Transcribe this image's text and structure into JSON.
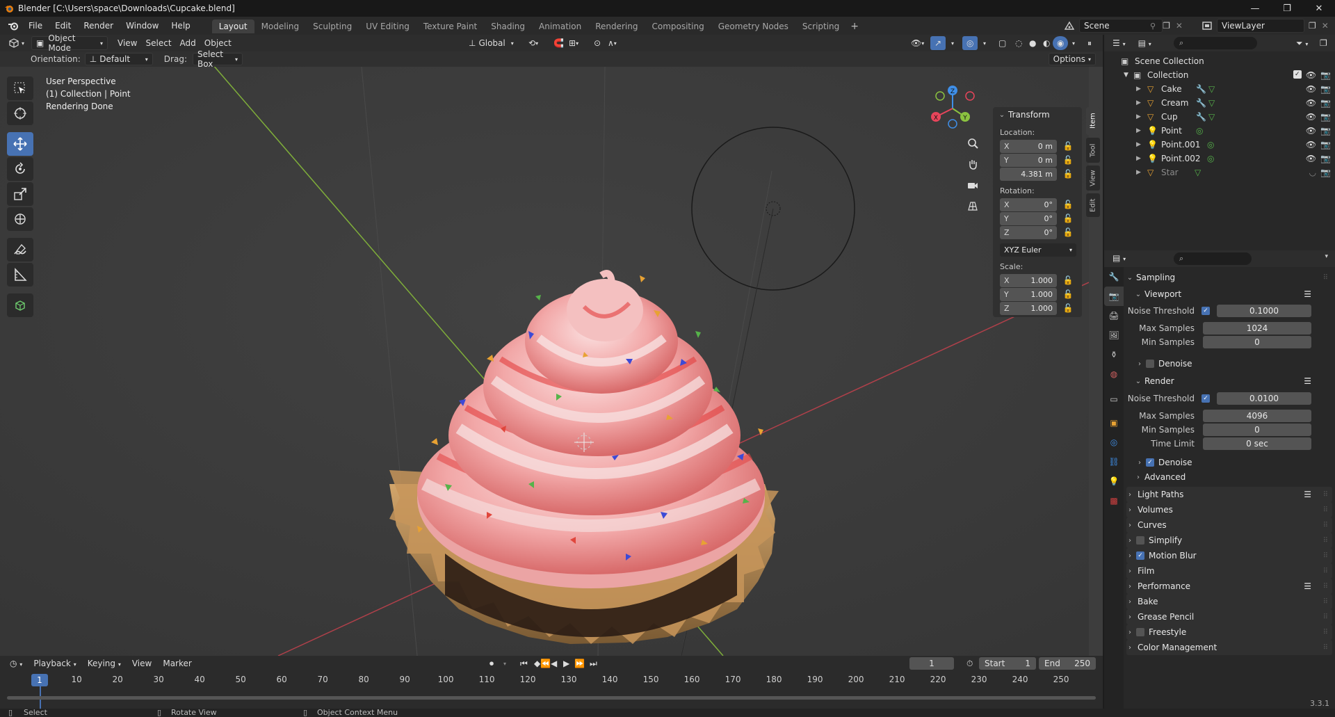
{
  "window": {
    "title": "Blender [C:\\Users\\space\\Downloads\\Cupcake.blend]",
    "minimize": "—",
    "maximize": "❐",
    "close": "✕"
  },
  "menubar": {
    "menus": [
      "File",
      "Edit",
      "Render",
      "Window",
      "Help"
    ],
    "workspaces": [
      "Layout",
      "Modeling",
      "Sculpting",
      "UV Editing",
      "Texture Paint",
      "Shading",
      "Animation",
      "Rendering",
      "Compositing",
      "Geometry Nodes",
      "Scripting"
    ],
    "active_workspace": "Layout",
    "add_tab": "+",
    "scene": "Scene",
    "view_layer": "ViewLayer"
  },
  "viewport": {
    "mode": "Object Mode",
    "menus": [
      "View",
      "Select",
      "Add",
      "Object"
    ],
    "transform_orientation": "Global",
    "orientation_label": "Orientation:",
    "orientation_value": "Default",
    "drag_label": "Drag:",
    "drag_value": "Select Box",
    "options": "Options",
    "overlay_lines": [
      "User Perspective",
      "(1) Collection | Point",
      "Rendering Done"
    ],
    "shading_mode": "rendered"
  },
  "npanel": {
    "title": "Transform",
    "location_label": "Location:",
    "location": [
      {
        "axis": "X",
        "value": "0 m"
      },
      {
        "axis": "Y",
        "value": "0 m"
      },
      {
        "axis": "",
        "value": "4.381 m"
      }
    ],
    "rotation_label": "Rotation:",
    "rotation": [
      {
        "axis": "X",
        "value": "0°"
      },
      {
        "axis": "Y",
        "value": "0°"
      },
      {
        "axis": "Z",
        "value": "0°"
      }
    ],
    "rotation_mode": "XYZ Euler",
    "scale_label": "Scale:",
    "scale": [
      {
        "axis": "X",
        "value": "1.000"
      },
      {
        "axis": "Y",
        "value": "1.000"
      },
      {
        "axis": "Z",
        "value": "1.000"
      }
    ],
    "tabs": [
      "Item",
      "Tool",
      "View",
      "Edit"
    ],
    "active_tab": "Item"
  },
  "gizmo": {
    "x": "X",
    "y": "Y",
    "z": "Z"
  },
  "timeline": {
    "menus": [
      "Playback",
      "Keying",
      "View",
      "Marker"
    ],
    "current_frame": "1",
    "start_label": "Start",
    "start": "1",
    "end_label": "End",
    "end": "250",
    "ticks": [
      "10",
      "20",
      "30",
      "40",
      "50",
      "60",
      "70",
      "80",
      "90",
      "100",
      "110",
      "120",
      "130",
      "140",
      "150",
      "160",
      "170",
      "180",
      "190",
      "200",
      "210",
      "220",
      "230",
      "240",
      "250"
    ],
    "playhead": "1"
  },
  "statusbar": {
    "hints": [
      "Select",
      "Rotate View",
      "Object Context Menu"
    ],
    "version": "3.3.1"
  },
  "outliner": {
    "root": "Scene Collection",
    "collection": "Collection",
    "items": [
      {
        "name": "Cake",
        "type": "mesh",
        "visible": true
      },
      {
        "name": "Cream",
        "type": "mesh",
        "visible": true
      },
      {
        "name": "Cup",
        "type": "mesh",
        "visible": true
      },
      {
        "name": "Point",
        "type": "light",
        "visible": true
      },
      {
        "name": "Point.001",
        "type": "light",
        "visible": true
      },
      {
        "name": "Point.002",
        "type": "light",
        "visible": true
      },
      {
        "name": "Star",
        "type": "mesh",
        "visible": false
      }
    ]
  },
  "properties": {
    "sampling": "Sampling",
    "viewport": "Viewport",
    "viewport_noise_label": "Noise Threshold",
    "viewport_noise": "0.1000",
    "viewport_max_label": "Max Samples",
    "viewport_max": "1024",
    "viewport_min_label": "Min Samples",
    "viewport_min": "0",
    "viewport_denoise": "Denoise",
    "render": "Render",
    "render_noise_label": "Noise Threshold",
    "render_noise": "0.0100",
    "render_max_label": "Max Samples",
    "render_max": "4096",
    "render_min_label": "Min Samples",
    "render_min": "0",
    "time_limit_label": "Time Limit",
    "time_limit": "0 sec",
    "render_denoise": "Denoise",
    "advanced": "Advanced",
    "panels": [
      {
        "label": "Light Paths",
        "checkbox": null,
        "list": true
      },
      {
        "label": "Volumes",
        "checkbox": null,
        "list": false
      },
      {
        "label": "Curves",
        "checkbox": null,
        "list": false
      },
      {
        "label": "Simplify",
        "checkbox": false,
        "list": false
      },
      {
        "label": "Motion Blur",
        "checkbox": true,
        "list": false
      },
      {
        "label": "Film",
        "checkbox": null,
        "list": false
      },
      {
        "label": "Performance",
        "checkbox": null,
        "list": true
      },
      {
        "label": "Bake",
        "checkbox": null,
        "list": false
      },
      {
        "label": "Grease Pencil",
        "checkbox": null,
        "list": false
      },
      {
        "label": "Freestyle",
        "checkbox": false,
        "list": false
      },
      {
        "label": "Color Management",
        "checkbox": null,
        "list": false
      }
    ]
  },
  "colors": {
    "accent": "#4772b3",
    "x_axis": "#e8455b",
    "y_axis": "#8bc240",
    "z_axis": "#3f8fe8",
    "frosting": "#f1a9a9"
  }
}
